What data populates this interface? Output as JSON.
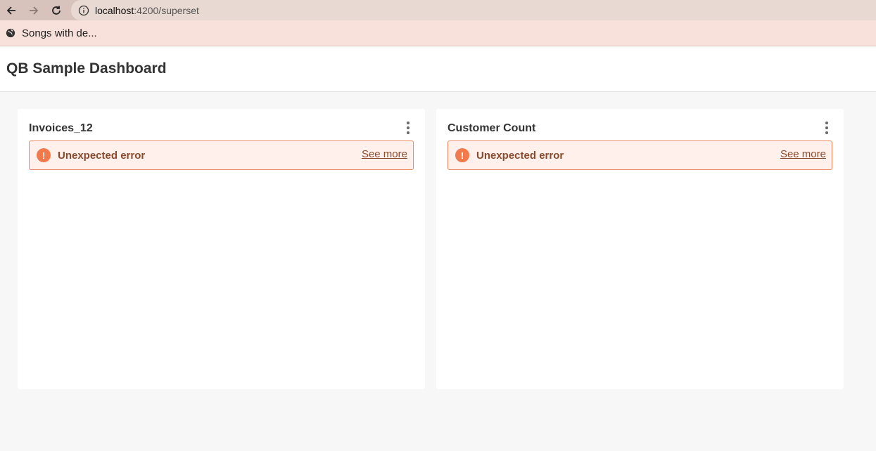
{
  "browser": {
    "url_host": "localhost",
    "url_path": ":4200/superset",
    "bookmark_label": "Songs with de..."
  },
  "header": {
    "title": "QB Sample Dashboard"
  },
  "charts": [
    {
      "title": "Invoices_12",
      "error_message": "Unexpected error",
      "see_more_label": "See more"
    },
    {
      "title": "Customer Count",
      "error_message": "Unexpected error",
      "see_more_label": "See more"
    }
  ],
  "colors": {
    "alert_bg": "#fff0ec",
    "alert_border": "#e8895f",
    "alert_icon": "#f2794b",
    "alert_text": "#8a4a2d"
  },
  "icons": {
    "back": "arrow-left-icon",
    "forward": "arrow-right-icon",
    "reload": "reload-icon",
    "site_info": "info-icon",
    "bookmark": "globe-icon",
    "alert": "exclamation-icon",
    "menu": "kebab-menu-icon"
  }
}
